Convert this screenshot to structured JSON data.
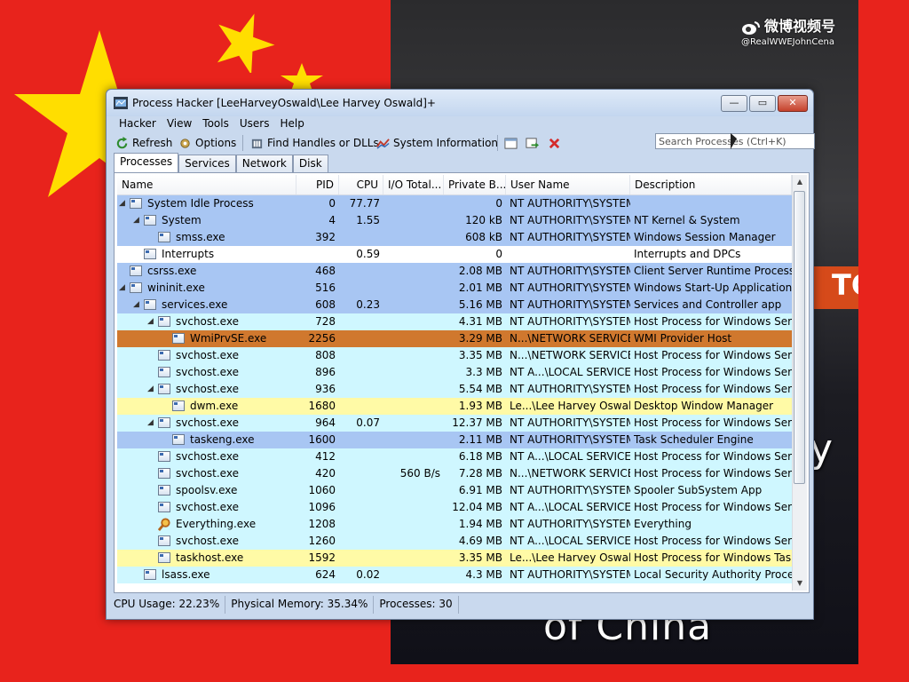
{
  "background": {
    "flag_color": "#e8231c",
    "star_color": "#ffde00",
    "watermark": {
      "brand": "微博视频号",
      "handle": "@RealWWEJohnCena"
    },
    "caption": "of China",
    "side_letter": "y",
    "sign_text": "TC"
  },
  "window": {
    "title": "Process Hacker [LeeHarveyOswald\\Lee Harvey Oswald]+",
    "controls": {
      "minimize": "—",
      "maximize": "▭",
      "close": "✕"
    }
  },
  "menu": [
    "Hacker",
    "View",
    "Tools",
    "Users",
    "Help"
  ],
  "toolbar": {
    "refresh": "Refresh",
    "options": "Options",
    "find_handles": "Find Handles or DLLs",
    "system_information": "System Information",
    "search_placeholder": "Search Processes (Ctrl+K)"
  },
  "tabs": [
    "Processes",
    "Services",
    "Network",
    "Disk"
  ],
  "columns": [
    "Name",
    "PID",
    "CPU",
    "I/O Total...",
    "Private B...",
    "User Name",
    "Description"
  ],
  "processes": [
    {
      "name": "System Idle Process",
      "pid": "0",
      "cpu": "77.77",
      "io": "",
      "priv": "0",
      "user": "NT AUTHORITY\\SYSTEM",
      "desc": "",
      "level": 0,
      "expand": "◢",
      "color": "blue"
    },
    {
      "name": "System",
      "pid": "4",
      "cpu": "1.55",
      "io": "",
      "priv": "120 kB",
      "user": "NT AUTHORITY\\SYSTEM",
      "desc": "NT Kernel & System",
      "level": 1,
      "expand": "◢",
      "color": "blue"
    },
    {
      "name": "smss.exe",
      "pid": "392",
      "cpu": "",
      "io": "",
      "priv": "608 kB",
      "user": "NT AUTHORITY\\SYSTEM",
      "desc": "Windows Session Manager",
      "level": 2,
      "expand": "",
      "color": "blue"
    },
    {
      "name": "Interrupts",
      "pid": "",
      "cpu": "0.59",
      "io": "",
      "priv": "0",
      "user": "",
      "desc": "Interrupts and DPCs",
      "level": 1,
      "expand": "",
      "color": "white"
    },
    {
      "name": "csrss.exe",
      "pid": "468",
      "cpu": "",
      "io": "",
      "priv": "2.08 MB",
      "user": "NT AUTHORITY\\SYSTEM",
      "desc": "Client Server Runtime Process",
      "level": 0,
      "expand": "",
      "color": "blue"
    },
    {
      "name": "wininit.exe",
      "pid": "516",
      "cpu": "",
      "io": "",
      "priv": "2.01 MB",
      "user": "NT AUTHORITY\\SYSTEM",
      "desc": "Windows Start-Up Application",
      "level": 0,
      "expand": "◢",
      "color": "blue"
    },
    {
      "name": "services.exe",
      "pid": "608",
      "cpu": "0.23",
      "io": "",
      "priv": "5.16 MB",
      "user": "NT AUTHORITY\\SYSTEM",
      "desc": "Services and Controller app",
      "level": 1,
      "expand": "◢",
      "color": "blue"
    },
    {
      "name": "svchost.exe",
      "pid": "728",
      "cpu": "",
      "io": "",
      "priv": "4.31 MB",
      "user": "NT AUTHORITY\\SYSTEM",
      "desc": "Host Process for Windows Ser...",
      "level": 2,
      "expand": "◢",
      "color": "cyan"
    },
    {
      "name": "WmiPrvSE.exe",
      "pid": "2256",
      "cpu": "",
      "io": "",
      "priv": "3.29 MB",
      "user": "N...\\NETWORK SERVICE",
      "desc": "WMI Provider Host",
      "level": 3,
      "expand": "",
      "color": "orange"
    },
    {
      "name": "svchost.exe",
      "pid": "808",
      "cpu": "",
      "io": "",
      "priv": "3.35 MB",
      "user": "N...\\NETWORK SERVICE",
      "desc": "Host Process for Windows Ser...",
      "level": 2,
      "expand": "",
      "color": "cyan"
    },
    {
      "name": "svchost.exe",
      "pid": "896",
      "cpu": "",
      "io": "",
      "priv": "3.3 MB",
      "user": "NT A...\\LOCAL SERVICE",
      "desc": "Host Process for Windows Ser...",
      "level": 2,
      "expand": "",
      "color": "cyan"
    },
    {
      "name": "svchost.exe",
      "pid": "936",
      "cpu": "",
      "io": "",
      "priv": "5.54 MB",
      "user": "NT AUTHORITY\\SYSTEM",
      "desc": "Host Process for Windows Ser...",
      "level": 2,
      "expand": "◢",
      "color": "cyan"
    },
    {
      "name": "dwm.exe",
      "pid": "1680",
      "cpu": "",
      "io": "",
      "priv": "1.93 MB",
      "user": "Le...\\Lee Harvey Oswald",
      "desc": "Desktop Window Manager",
      "level": 3,
      "expand": "",
      "color": "yellow"
    },
    {
      "name": "svchost.exe",
      "pid": "964",
      "cpu": "0.07",
      "io": "",
      "priv": "12.37 MB",
      "user": "NT AUTHORITY\\SYSTEM",
      "desc": "Host Process for Windows Ser...",
      "level": 2,
      "expand": "◢",
      "color": "cyan"
    },
    {
      "name": "taskeng.exe",
      "pid": "1600",
      "cpu": "",
      "io": "",
      "priv": "2.11 MB",
      "user": "NT AUTHORITY\\SYSTEM",
      "desc": "Task Scheduler Engine",
      "level": 3,
      "expand": "",
      "color": "blue"
    },
    {
      "name": "svchost.exe",
      "pid": "412",
      "cpu": "",
      "io": "",
      "priv": "6.18 MB",
      "user": "NT A...\\LOCAL SERVICE",
      "desc": "Host Process for Windows Ser...",
      "level": 2,
      "expand": "",
      "color": "cyan"
    },
    {
      "name": "svchost.exe",
      "pid": "420",
      "cpu": "",
      "io": "560 B/s",
      "priv": "7.28 MB",
      "user": "N...\\NETWORK SERVICE",
      "desc": "Host Process for Windows Ser...",
      "level": 2,
      "expand": "",
      "color": "cyan"
    },
    {
      "name": "spoolsv.exe",
      "pid": "1060",
      "cpu": "",
      "io": "",
      "priv": "6.91 MB",
      "user": "NT AUTHORITY\\SYSTEM",
      "desc": "Spooler SubSystem App",
      "level": 2,
      "expand": "",
      "color": "cyan"
    },
    {
      "name": "svchost.exe",
      "pid": "1096",
      "cpu": "",
      "io": "",
      "priv": "12.04 MB",
      "user": "NT A...\\LOCAL SERVICE",
      "desc": "Host Process for Windows Ser...",
      "level": 2,
      "expand": "",
      "color": "cyan"
    },
    {
      "name": "Everything.exe",
      "pid": "1208",
      "cpu": "",
      "io": "",
      "priv": "1.94 MB",
      "user": "NT AUTHORITY\\SYSTEM",
      "desc": "Everything",
      "level": 2,
      "expand": "",
      "color": "cyan",
      "icon": "magnifier"
    },
    {
      "name": "svchost.exe",
      "pid": "1260",
      "cpu": "",
      "io": "",
      "priv": "4.69 MB",
      "user": "NT A...\\LOCAL SERVICE",
      "desc": "Host Process for Windows Ser...",
      "level": 2,
      "expand": "",
      "color": "cyan"
    },
    {
      "name": "taskhost.exe",
      "pid": "1592",
      "cpu": "",
      "io": "",
      "priv": "3.35 MB",
      "user": "Le...\\Lee Harvey Oswald",
      "desc": "Host Process for Windows Tas...",
      "level": 2,
      "expand": "",
      "color": "yellow"
    },
    {
      "name": "lsass.exe",
      "pid": "624",
      "cpu": "0.02",
      "io": "",
      "priv": "4.3 MB",
      "user": "NT AUTHORITY\\SYSTEM",
      "desc": "Local Security Authority Proce...",
      "level": 1,
      "expand": "",
      "color": "cyan"
    }
  ],
  "status": {
    "cpu": "CPU Usage: 22.23%",
    "memory": "Physical Memory: 35.34%",
    "processes": "Processes: 30"
  },
  "colors": {
    "blue": "#a8c6f3",
    "cyan": "#cff7ff",
    "yellow": "#fffaa6",
    "orange": "#d0782e",
    "white": "#ffffff"
  }
}
